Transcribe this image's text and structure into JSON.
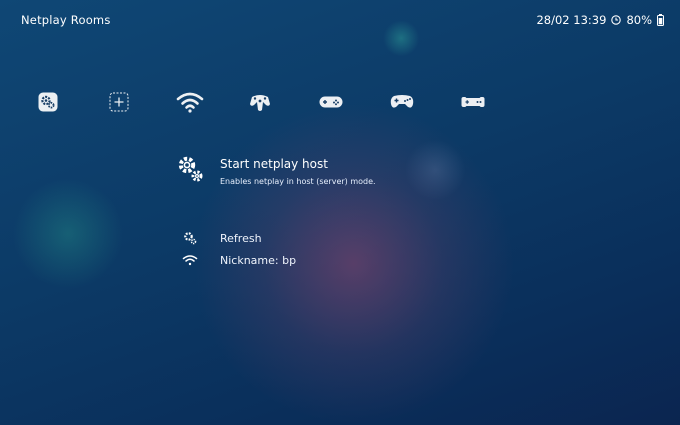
{
  "header": {
    "title": "Netplay Rooms",
    "datetime": "28/02 13:39",
    "battery": "80%",
    "clock_icon": "clock-icon",
    "battery_icon": "battery-icon"
  },
  "nav": {
    "tabs": [
      {
        "icon": "settings-icon",
        "selected": false
      },
      {
        "icon": "add-icon",
        "selected": false
      },
      {
        "icon": "wifi-icon",
        "selected": true
      },
      {
        "icon": "n64-controller-icon",
        "selected": false
      },
      {
        "icon": "snes-controller-icon",
        "selected": false
      },
      {
        "icon": "genesis-controller-icon",
        "selected": false
      },
      {
        "icon": "nes-controller-icon",
        "selected": false
      }
    ]
  },
  "menu": {
    "selected": {
      "label": "Start netplay host",
      "sublabel": "Enables netplay in host (server) mode.",
      "icon": "gears-icon"
    },
    "items": [
      {
        "label": "Refresh",
        "icon": "gears-icon"
      },
      {
        "label": "Nickname: bp",
        "icon": "wifi-icon"
      }
    ]
  },
  "colors": {
    "background": "#0c3a66",
    "text": "#ffffff",
    "accent_glow": "#96466e"
  }
}
